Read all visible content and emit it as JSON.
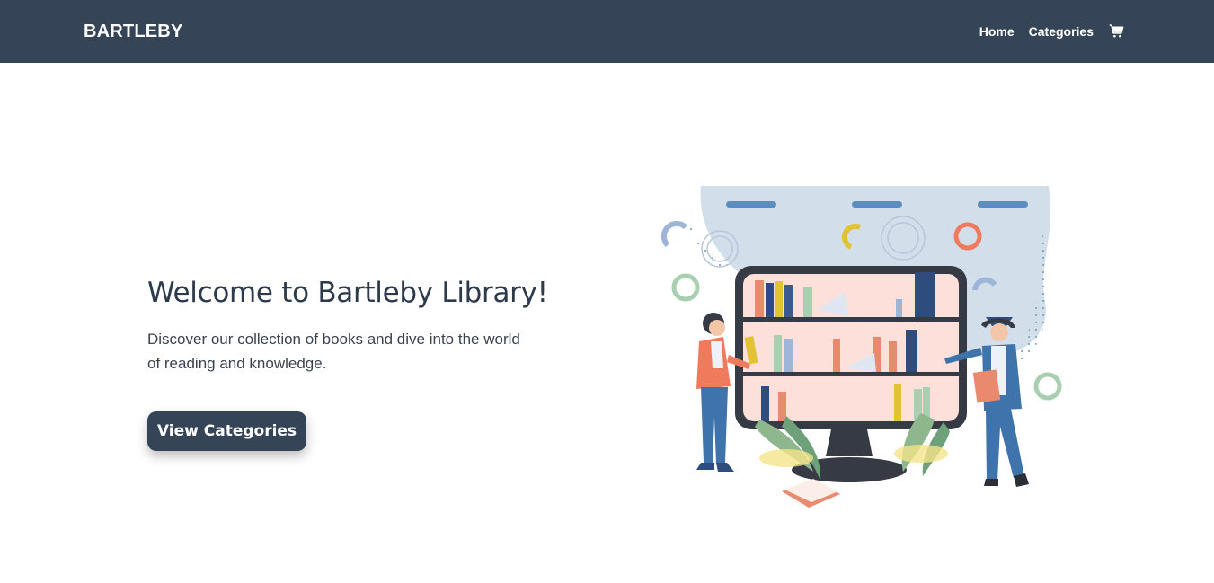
{
  "navbar": {
    "brand": "BARTLEBY",
    "links": [
      {
        "label": "Home"
      },
      {
        "label": "Categories"
      }
    ],
    "cart_icon": "shopping-cart-icon",
    "background": "#354557"
  },
  "hero": {
    "title": "Welcome to Bartleby Library!",
    "description": "Discover our collection of books and dive into the world of reading and knowledge.",
    "button_label": "View Categories",
    "illustration": "library-bookshelf-illustration"
  },
  "colors": {
    "primary": "#354557",
    "text": "#2c3a4b",
    "background": "#ffffff"
  }
}
